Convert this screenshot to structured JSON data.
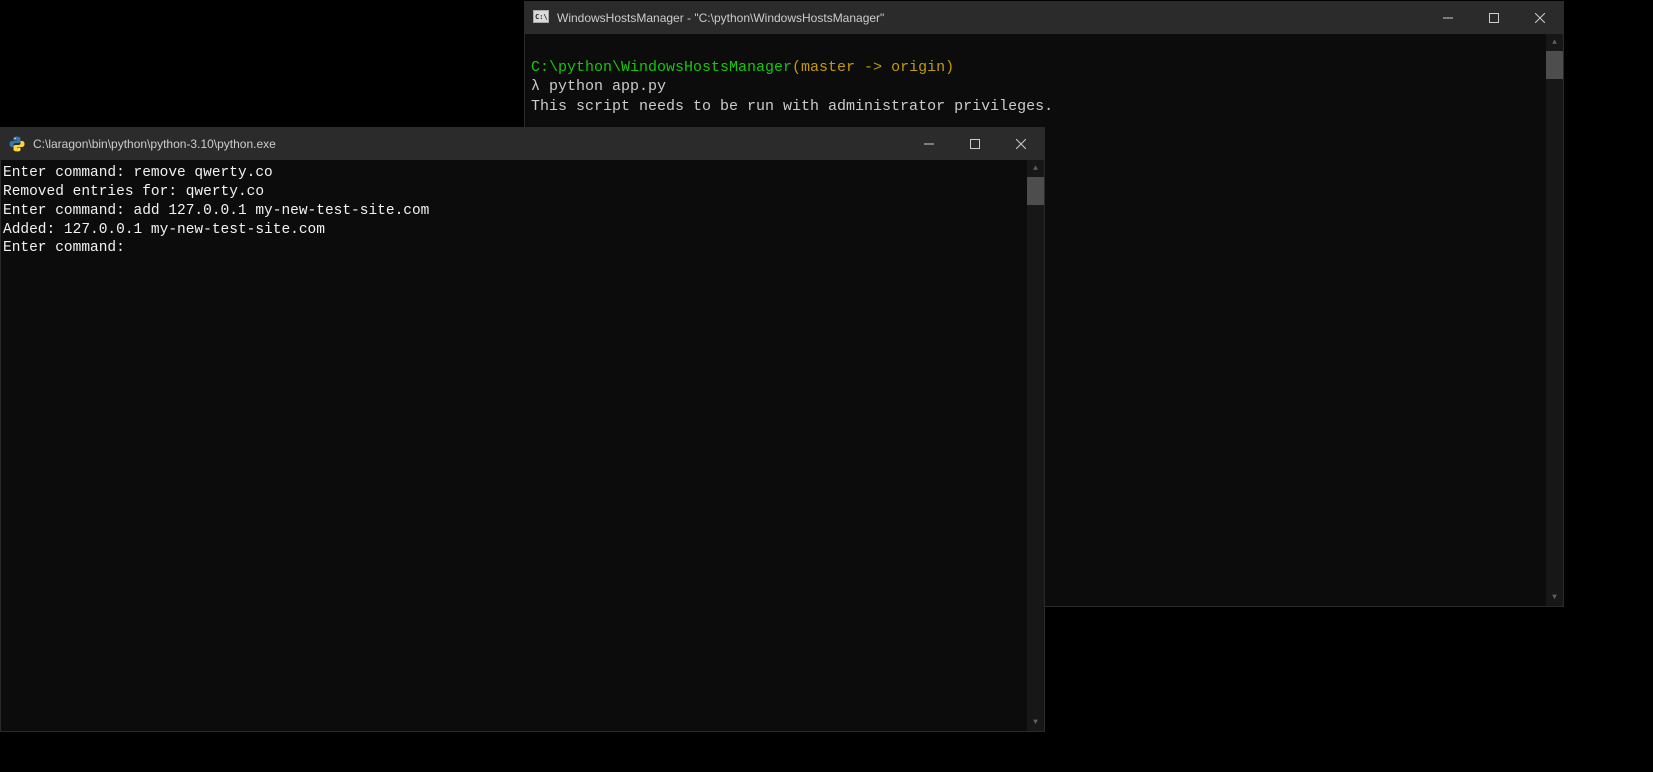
{
  "back_window": {
    "title": "WindowsHostsManager - \"C:\\python\\WindowsHostsManager\"",
    "prompt_path": "C:\\python\\WindowsHostsManager",
    "prompt_branch": "(master -> origin)",
    "lambda": "λ",
    "command": "python app.py",
    "output_line": "This script needs to be run with administrator privileges."
  },
  "front_window": {
    "title": "C:\\laragon\\bin\\python\\python-3.10\\python.exe",
    "lines": [
      "Enter command: remove qwerty.co",
      "Removed entries for: qwerty.co",
      "Enter command: add 127.0.0.1 my-new-test-site.com",
      "Added: 127.0.0.1 my-new-test-site.com",
      "Enter command: "
    ]
  }
}
